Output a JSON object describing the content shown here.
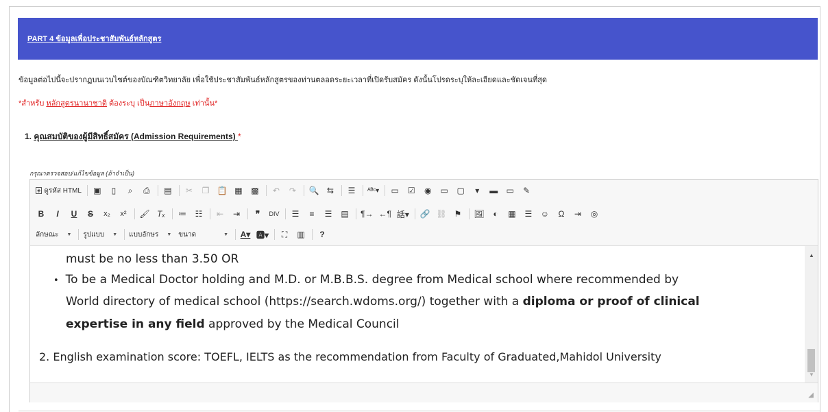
{
  "header": {
    "title": "PART 4 ข้อมูลเพื่อประชาสัมพันธ์หลักสูตร",
    "bg_color": "#4654cc"
  },
  "intro_text": "ข้อมูลต่อไปนี้จะปรากฏบนเวบไซต์ของบัณฑิตวิทยาลัย เพื่อใช้ประชาสัมพันธ์หลักสูตรของท่านตลอดระยะเวลาที่เปิดรับสมัคร ดังนั้นโปรดระบุให้ละเอียดและชัดเจนที่สุด",
  "notice": {
    "prefix": "*สำหรับ ",
    "link1": "หลักสูตรนานาชาติ",
    "mid": " ต้องระบุ เป็น",
    "link2": "ภาษาอังกฤษ",
    "suffix": " เท่านั้น*",
    "color": "#e02020"
  },
  "question": {
    "number": "1.",
    "title": "คุณสมบัติของผู้มีสิทธิ์สมัคร (Admission Requirements) ",
    "required_mark": "*"
  },
  "hint": "กรุณาตรวจสอบ/แก้ไขข้อมูล (ถ้าจำเป็น)",
  "toolbar": {
    "source_label": "ดูรหัส HTML",
    "style_label": "ลักษณะ",
    "format_label": "รูปแบบ",
    "font_label": "แบบอักษร",
    "size_label": "ขนาด",
    "help_label": "?"
  },
  "content": {
    "line1": "must be no less than 3.50 OR",
    "bullet": "•",
    "line2": "To be a Medical Doctor holding and M.D. or M.B.B.S. degree from Medical school where recommended by",
    "line3_normal": "World directory of medical school  (https://search.wdoms.org/)  together with a ",
    "line3_bold": "diploma or proof of clinical",
    "line4_bold": "expertise in any field",
    "line4_normal": " approved by the Medical Council",
    "line5": "2. English examination score: TOEFL, IELTS  as the recommendation from Faculty of Graduated,Mahidol University"
  }
}
